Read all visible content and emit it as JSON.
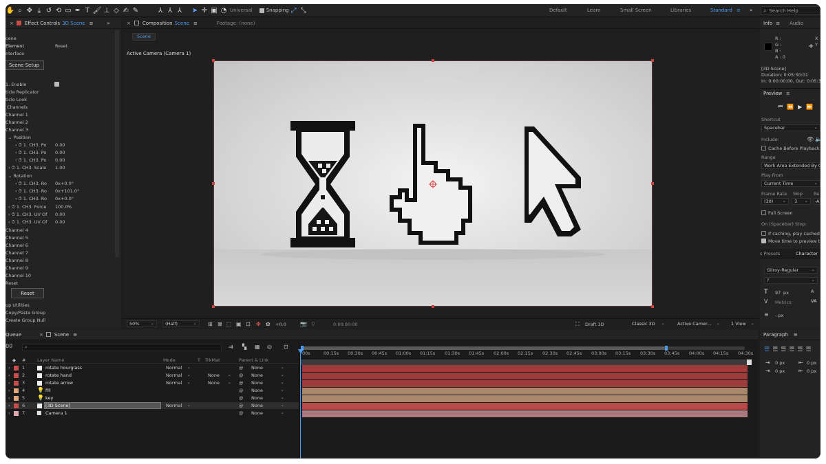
{
  "toolbar": {
    "universal": "Universal",
    "snapping": "Snapping",
    "workspaces": [
      "Default",
      "Learn",
      "Small Screen",
      "Libraries",
      "Standard"
    ],
    "search_placeholder": "Search Help"
  },
  "effect_panel": {
    "tab_label": "Effect Controls",
    "tab_target": "3D Scene",
    "header_col1": "cene",
    "element": "Element",
    "reset_link": "Reset",
    "interface": "nterface",
    "scene_setup": "Scene Setup",
    "enable": "1. Enable",
    "rows": [
      {
        "label": "ticle Replicator",
        "val": ""
      },
      {
        "label": "ticle Look",
        "val": ""
      },
      {
        "label": "Channels",
        "val": ""
      },
      {
        "label": "Channel 1",
        "val": ""
      },
      {
        "label": "Channel 2",
        "val": ""
      },
      {
        "label": "Channel 3",
        "val": ""
      }
    ],
    "position": "Position",
    "pos_rows": [
      {
        "label": "1. CH3. Po",
        "val": "0.00"
      },
      {
        "label": "1. CH3. Po",
        "val": "0.00"
      },
      {
        "label": "1. CH3. Po",
        "val": "0.00"
      }
    ],
    "scale_label": "1. CH3. Scale",
    "scale_val": "1.00",
    "rotation": "Rotation",
    "rot_rows": [
      {
        "label": "1. CH3. Ro",
        "val": "0x+0.0°"
      },
      {
        "label": "1. CH3. Ro",
        "val": "0x+101.0°"
      },
      {
        "label": "1. CH3. Ro",
        "val": "0x+0.0°"
      }
    ],
    "force_label": "1. CH3. Force",
    "force_val": "100.0",
    "force_unit": "%",
    "uv_rows": [
      {
        "label": "1. CH3. UV Of",
        "val": "0.00"
      },
      {
        "label": "1. CH3. UV Of",
        "val": "0.00"
      }
    ],
    "channels_more": [
      "Channel 4",
      "Channel 5",
      "Channel 6",
      "Channel 7",
      "Channel 8",
      "Channel 9",
      "Channel 10"
    ],
    "reset_label": "Reset",
    "reset_button": "Reset",
    "tail": [
      "up Utilities",
      "Copy/Paste Group",
      "Create Group Null"
    ]
  },
  "comp_panel": {
    "tab_label": "Composition",
    "tab_target": "Scene",
    "footage": "Footage: (none)",
    "subtab": "Scene",
    "camera_label": "Active Camera (Camera 1)",
    "zoom": "50%",
    "resolution": "(Half)",
    "exposure": "+0.0",
    "timecode": "0:00:00:00",
    "renderer_label": "Draft 3D",
    "renderer": "Classic 3D",
    "camera_select": "Active Camer...",
    "views": "1 View"
  },
  "info_panel": {
    "tab_info": "Info",
    "tab_audio": "Audio",
    "r": "R :",
    "g": "G :",
    "b": "B :",
    "a": "A : 0",
    "comp": "[3D Scene]",
    "duration": "Duration: 0:05:30:01",
    "inout": "In: 0:00:00:00, Out: 0:05:30"
  },
  "preview_panel": {
    "title": "Preview",
    "shortcut_label": "Shortcut",
    "shortcut": "Spacebar",
    "include": "Include:",
    "cache": "Cache Before Playback",
    "range_label": "Range",
    "range": "Work Area Extended By C",
    "play_from_label": "Play From",
    "play_from": "Current Time",
    "frame_rate": "Frame Rate",
    "skip": "Skip",
    "res": "Re",
    "fr_val": "(30)",
    "skip_val": "3",
    "res_val": "A",
    "full_screen": "Full Screen",
    "on_stop": "On (Spacebar) Stop:",
    "if_caching": "If caching, play cached f",
    "move_time": "Move time to preview t"
  },
  "character_panel": {
    "tab_presets": "s Presets",
    "tab_character": "Character",
    "font": "Gilroy-Regular",
    "style": "?",
    "size": "97",
    "size_unit": "px",
    "kerning": "Metrics",
    "stroke": "- px"
  },
  "paragraph_panel": {
    "title": "Paragraph",
    "indent1": "0 px",
    "indent2": "0 px",
    "indent3": "0 px",
    "indent4": "0 px"
  },
  "timeline": {
    "queue_tab": "Queue",
    "scene_tab": "Scene",
    "timecode": "00",
    "columns": {
      "layer_name": "Layer Name",
      "mode": "Mode",
      "t": "T",
      "trkmat": "TrkMat",
      "parent": "Parent & Link"
    },
    "layers": [
      {
        "num": "1",
        "name": "rotate hourglass",
        "mode": "Normal",
        "trkmat": "",
        "parent": "None",
        "label_color": "#c94d4d",
        "bar_color": "#9e3b3b",
        "icon": "solid"
      },
      {
        "num": "2",
        "name": "rotate hand",
        "mode": "Normal",
        "trkmat": "None",
        "parent": "None",
        "label_color": "#c94d4d",
        "bar_color": "#9e3b3b",
        "icon": "solid"
      },
      {
        "num": "3",
        "name": "rotate arrow",
        "mode": "Normal",
        "trkmat": "None",
        "parent": "None",
        "label_color": "#c94d4d",
        "bar_color": "#9e3b3b",
        "icon": "solid"
      },
      {
        "num": "4",
        "name": "fill",
        "mode": "",
        "trkmat": "",
        "parent": "None",
        "label_color": "#e0a87a",
        "bar_color": "#a8876a",
        "icon": "light"
      },
      {
        "num": "5",
        "name": "key",
        "mode": "",
        "trkmat": "",
        "parent": "None",
        "label_color": "#e0a87a",
        "bar_color": "#a8876a",
        "icon": "light"
      },
      {
        "num": "6",
        "name": "[3D Scene]",
        "mode": "Normal",
        "trkmat": "",
        "parent": "None",
        "label_color": "#c94d4d",
        "bar_color": "#b84a4a",
        "icon": "solid"
      },
      {
        "num": "7",
        "name": "Camera 1",
        "mode": "",
        "trkmat": "",
        "parent": "None",
        "label_color": "#e0a8b0",
        "bar_color": "#a87a80",
        "icon": "camera"
      }
    ],
    "ruler": [
      "00s",
      "00:15s",
      "00:30s",
      "00:45s",
      "01:00s",
      "01:15s",
      "01:30s",
      "01:45s",
      "02:00s",
      "02:15s",
      "02:30s",
      "02:45s",
      "03:00s",
      "03:15s",
      "03:30s",
      "03:45s",
      "04:00s",
      "04:15s",
      "04:30s"
    ]
  }
}
